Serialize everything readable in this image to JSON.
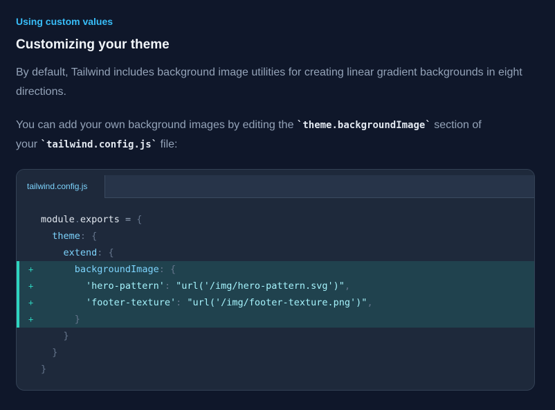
{
  "section": {
    "eyebrow": "Using custom values",
    "title": "Customizing your theme",
    "paragraph_1": "By default, Tailwind includes background image utilities for creating linear gradient backgrounds in eight directions.",
    "paragraph_2_before": "You can add your own background images by editing the ",
    "paragraph_2_code_1": "`theme.backgroundImage`",
    "paragraph_2_middle_1": " section of",
    "paragraph_2_middle_2": "your ",
    "paragraph_2_code_2": "`tailwind.config.js`",
    "paragraph_2_after": " file:"
  },
  "code_panel": {
    "tab_label": "tailwind.config.js",
    "diff_marker": "+",
    "lines": [
      {
        "indent": "",
        "t": [
          [
            "plain",
            "module"
          ],
          [
            "punct",
            "."
          ],
          [
            "plain",
            "exports "
          ],
          [
            "op",
            "= "
          ],
          [
            "punct",
            "{"
          ]
        ]
      },
      {
        "indent": "  ",
        "t": [
          [
            "prop",
            "theme"
          ],
          [
            "punct",
            ": {"
          ]
        ]
      },
      {
        "indent": "    ",
        "t": [
          [
            "prop",
            "extend"
          ],
          [
            "punct",
            ": {"
          ]
        ]
      },
      {
        "indent": "      ",
        "added": true,
        "t": [
          [
            "prop",
            "backgroundImage"
          ],
          [
            "punct",
            ": {"
          ]
        ]
      },
      {
        "indent": "        ",
        "added": true,
        "t": [
          [
            "str",
            "'hero-pattern'"
          ],
          [
            "punct",
            ": "
          ],
          [
            "str",
            "\"url('/img/hero-pattern.svg')\""
          ],
          [
            "punct",
            ","
          ]
        ]
      },
      {
        "indent": "        ",
        "added": true,
        "t": [
          [
            "str",
            "'footer-texture'"
          ],
          [
            "punct",
            ": "
          ],
          [
            "str",
            "\"url('/img/footer-texture.png')\""
          ],
          [
            "punct",
            ","
          ]
        ]
      },
      {
        "indent": "      ",
        "added": true,
        "t": [
          [
            "punct",
            "}"
          ]
        ]
      },
      {
        "indent": "    ",
        "t": [
          [
            "punct",
            "}"
          ]
        ]
      },
      {
        "indent": "  ",
        "t": [
          [
            "punct",
            "}"
          ]
        ]
      },
      {
        "indent": "",
        "t": [
          [
            "punct",
            "}"
          ]
        ]
      }
    ]
  },
  "colors": {
    "background": "#0f172a",
    "accent": "#38bdf8",
    "diff_added": "#2dd4bf"
  }
}
